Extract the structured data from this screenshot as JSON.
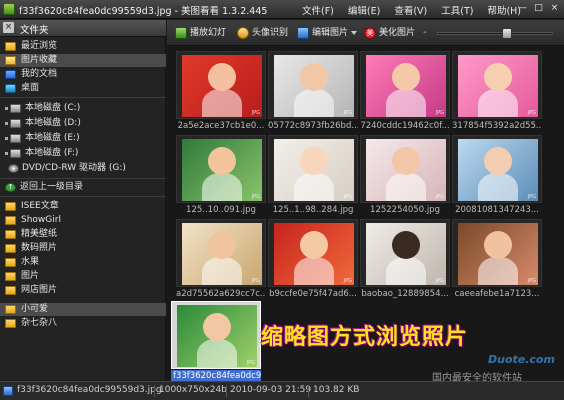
{
  "window": {
    "title": "f33f3620c84fea0dc99559d3.jpg - 美图看看 1.3.2.445",
    "menu": [
      "文件(F)",
      "编辑(E)",
      "查看(V)",
      "工具(T)",
      "帮助(H)"
    ],
    "controls": [
      "—",
      "□",
      "×"
    ]
  },
  "sidebar": {
    "header": "文件夹",
    "items": [
      "最近浏览",
      "图片收藏",
      "我的文档",
      "桌面"
    ],
    "drives": [
      "本地磁盘 (C:)",
      "本地磁盘 (D:)",
      "本地磁盘 (E:)",
      "本地磁盘 (F:)",
      "DVD/CD-RW 驱动器 (G:)"
    ],
    "up_label": "返回上一级目录",
    "folders": [
      "ISEE文章",
      "ShowGirl",
      "精美壁纸",
      "数码照片",
      "水果",
      "图片",
      "网店图片",
      "小可爱",
      "杂七杂八"
    ],
    "selected_folder": "小可爱",
    "selected_item": "图片收藏"
  },
  "toolbar": {
    "slideshow": "播放幻灯",
    "face": "头像识别",
    "edit": "编辑图片",
    "beautify": "美化图片",
    "beautify_badge": "美",
    "zoom_level": 0.62
  },
  "thumbnails": [
    {
      "name": "2a5e2ace37cb1e0..."
    },
    {
      "name": "05772c8973fb26bd..."
    },
    {
      "name": "7240cddc19462c0f..."
    },
    {
      "name": "317854f5392a2d55..."
    },
    {
      "name": "125..10..091.jpg"
    },
    {
      "name": "125..1..98..284.jpg"
    },
    {
      "name": "1252254050.jpg"
    },
    {
      "name": "20081081347243..."
    },
    {
      "name": "a2d75562a629cc7c..."
    },
    {
      "name": "b9ccfe0e75f47ad6..."
    },
    {
      "name": "baobao_12889854..."
    },
    {
      "name": "caeeafebe1a7123..."
    },
    {
      "name": "f33f3620c84fea0dc99"
    }
  ],
  "jpg_tag": "JPG",
  "banner": "缩略图方式浏览照片",
  "watermark": "国内最安全的软件站",
  "watermark_logo": "Duote.com",
  "status": {
    "filename": "f33f3620c84fea0dc99559d3.jpg",
    "dimensions": "1000x750x24b",
    "date": "2010-09-03 21:59",
    "size": "103.82 KB"
  }
}
